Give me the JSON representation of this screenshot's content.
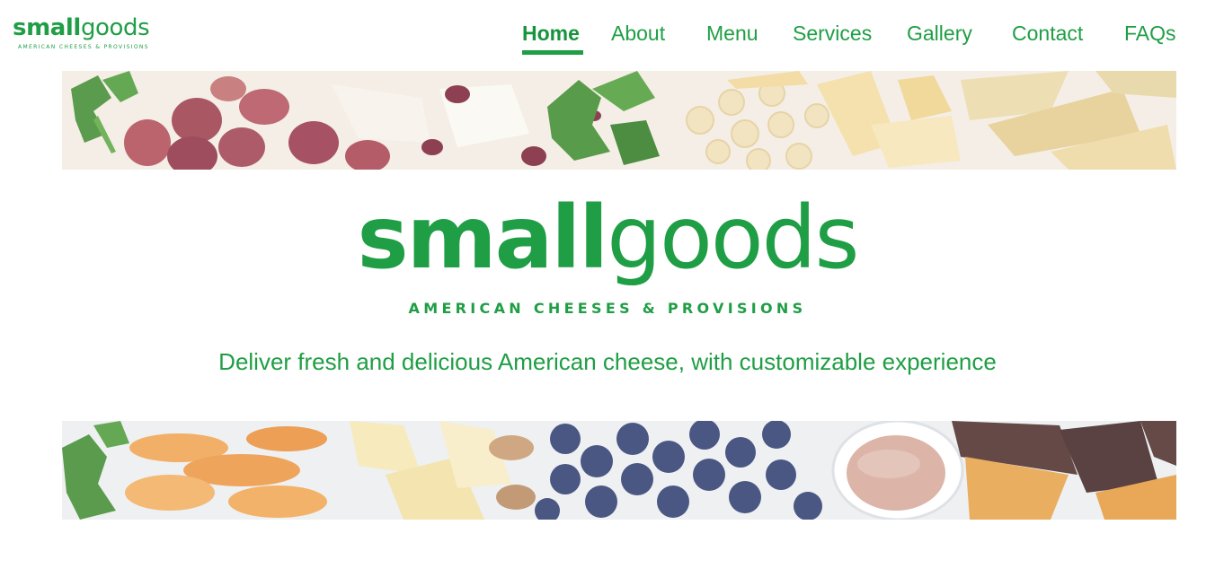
{
  "brand": {
    "name_bold": "small",
    "name_light": "goods",
    "tagline": "AMERICAN CHEESES & PROVISIONS",
    "color": "#1f9e45"
  },
  "nav": {
    "items": [
      {
        "label": "Home",
        "active": true
      },
      {
        "label": "About",
        "active": false
      },
      {
        "label": "Menu",
        "active": false
      },
      {
        "label": "Services",
        "active": false
      },
      {
        "label": "Gallery",
        "active": false
      },
      {
        "label": "Contact",
        "active": false
      },
      {
        "label": "FAQs",
        "active": false
      }
    ]
  },
  "hero": {
    "name_bold": "small",
    "name_light": "goods",
    "subtitle": "AMERICAN CHEESES & PROVISIONS",
    "tagline": "Deliver fresh and delicious American cheese, with customizable experience"
  },
  "banners": {
    "top_icon": "cheese-board-photo-icon",
    "bottom_icon": "fruit-board-photo-icon"
  }
}
